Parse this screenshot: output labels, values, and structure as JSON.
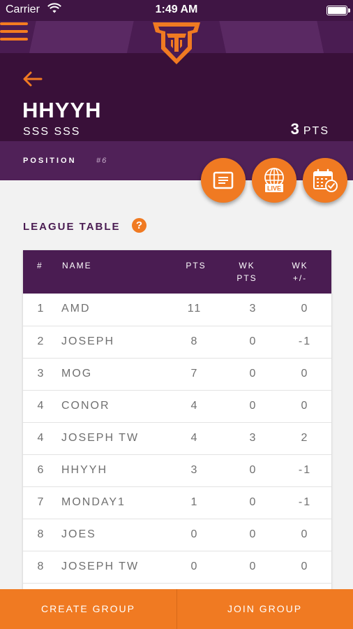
{
  "status_bar": {
    "carrier": "Carrier",
    "time": "1:49 AM"
  },
  "team": {
    "name": "HHYYH",
    "manager": "SSS SSS",
    "points": "3",
    "points_unit": "PTS"
  },
  "position": {
    "label": "POSITION",
    "value": "#6"
  },
  "actions": {
    "live_label": "LIVE"
  },
  "league_table": {
    "title": "LEAGUE TABLE",
    "help_label": "?",
    "columns": {
      "rank": "#",
      "name": "NAME",
      "pts": "PTS",
      "wk_pts_1": "WK",
      "wk_pts_2": "PTS",
      "wk_pm_1": "WK",
      "wk_pm_2": "+/-"
    },
    "rows": [
      {
        "rank": "1",
        "name": "AMD",
        "pts": "11",
        "wk_pts": "3",
        "wk_pm": "0"
      },
      {
        "rank": "2",
        "name": "JOSEPH",
        "pts": "8",
        "wk_pts": "0",
        "wk_pm": "-1"
      },
      {
        "rank": "3",
        "name": "MOG",
        "pts": "7",
        "wk_pts": "0",
        "wk_pm": "0"
      },
      {
        "rank": "4",
        "name": "CONOR",
        "pts": "4",
        "wk_pts": "0",
        "wk_pm": "0"
      },
      {
        "rank": "4",
        "name": "JOSEPH TW",
        "pts": "4",
        "wk_pts": "3",
        "wk_pm": "2"
      },
      {
        "rank": "6",
        "name": "HHYYH",
        "pts": "3",
        "wk_pts": "0",
        "wk_pm": "-1"
      },
      {
        "rank": "7",
        "name": "MONDAY1",
        "pts": "1",
        "wk_pts": "0",
        "wk_pm": "-1"
      },
      {
        "rank": "8",
        "name": "JOES",
        "pts": "0",
        "wk_pts": "0",
        "wk_pm": "0"
      },
      {
        "rank": "8",
        "name": "JOSEPH TW",
        "pts": "0",
        "wk_pts": "0",
        "wk_pm": "0"
      }
    ]
  },
  "bottom_bar": {
    "create_label": "CREATE GROUP",
    "join_label": "JOIN GROUP"
  },
  "colors": {
    "accent": "#f07a22",
    "purple_dark": "#391039",
    "purple": "#4a1c52",
    "purple_light": "#502158"
  }
}
